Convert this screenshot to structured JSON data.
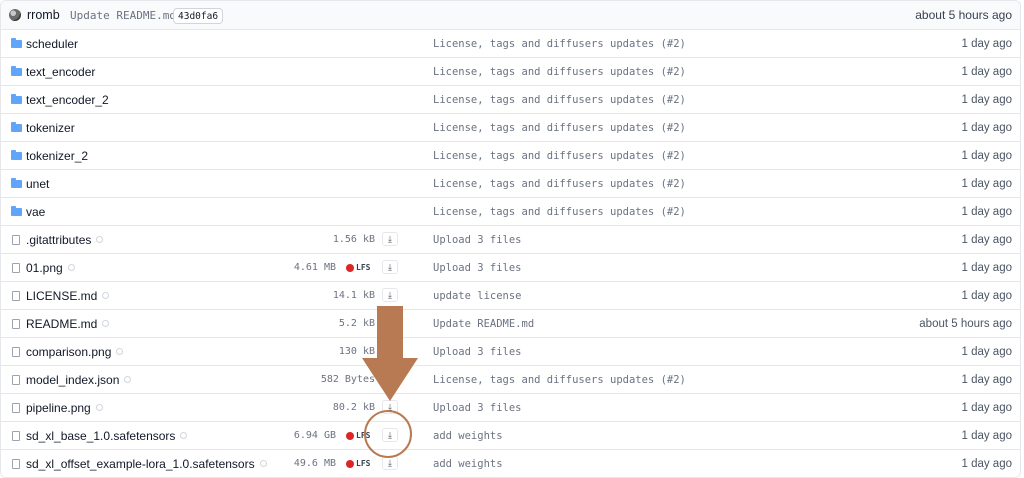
{
  "header": {
    "author": "rromb",
    "commit_message": "Update README.md",
    "commit_hash": "43d0fa6",
    "time": "about 5 hours ago"
  },
  "rows": [
    {
      "type": "folder",
      "name": "scheduler",
      "size": "",
      "lfs": false,
      "message": "License, tags and diffusers updates (#2)",
      "time": "1 day ago"
    },
    {
      "type": "folder",
      "name": "text_encoder",
      "size": "",
      "lfs": false,
      "message": "License, tags and diffusers updates (#2)",
      "time": "1 day ago"
    },
    {
      "type": "folder",
      "name": "text_encoder_2",
      "size": "",
      "lfs": false,
      "message": "License, tags and diffusers updates (#2)",
      "time": "1 day ago"
    },
    {
      "type": "folder",
      "name": "tokenizer",
      "size": "",
      "lfs": false,
      "message": "License, tags and diffusers updates (#2)",
      "time": "1 day ago"
    },
    {
      "type": "folder",
      "name": "tokenizer_2",
      "size": "",
      "lfs": false,
      "message": "License, tags and diffusers updates (#2)",
      "time": "1 day ago"
    },
    {
      "type": "folder",
      "name": "unet",
      "size": "",
      "lfs": false,
      "message": "License, tags and diffusers updates (#2)",
      "time": "1 day ago"
    },
    {
      "type": "folder",
      "name": "vae",
      "size": "",
      "lfs": false,
      "message": "License, tags and diffusers updates (#2)",
      "time": "1 day ago"
    },
    {
      "type": "file",
      "name": ".gitattributes",
      "size": "1.56 kB",
      "lfs": false,
      "message": "Upload 3 files",
      "time": "1 day ago"
    },
    {
      "type": "file",
      "name": "01.png",
      "size": "4.61 MB",
      "lfs": true,
      "lfs_label": "LFS",
      "message": "Upload 3 files",
      "time": "1 day ago"
    },
    {
      "type": "file",
      "name": "LICENSE.md",
      "size": "14.1 kB",
      "lfs": false,
      "message": "update license",
      "time": "1 day ago"
    },
    {
      "type": "file",
      "name": "README.md",
      "size": "5.2 kB",
      "lfs": false,
      "message": "Update README.md",
      "time": "about 5 hours ago"
    },
    {
      "type": "file",
      "name": "comparison.png",
      "size": "130 kB",
      "lfs": false,
      "message": "Upload 3 files",
      "time": "1 day ago"
    },
    {
      "type": "file",
      "name": "model_index.json",
      "size": "582 Bytes",
      "lfs": false,
      "message": "License, tags and diffusers updates (#2)",
      "time": "1 day ago"
    },
    {
      "type": "file",
      "name": "pipeline.png",
      "size": "80.2 kB",
      "lfs": false,
      "message": "Upload 3 files",
      "time": "1 day ago"
    },
    {
      "type": "file",
      "name": "sd_xl_base_1.0.safetensors",
      "size": "6.94 GB",
      "lfs": true,
      "lfs_label": "LFS",
      "message": "add weights",
      "time": "1 day ago"
    },
    {
      "type": "file",
      "name": "sd_xl_offset_example-lora_1.0.safetensors",
      "size": "49.6 MB",
      "lfs": true,
      "lfs_label": "LFS",
      "message": "add weights",
      "time": "1 day ago"
    }
  ],
  "icons": {
    "folder": "folder-icon",
    "file": "file-icon",
    "download": "download-icon",
    "security": "shield-icon"
  },
  "colors": {
    "folder": "#60a5fa",
    "lfs": "#dc2626",
    "annotation": "#b87a52"
  }
}
